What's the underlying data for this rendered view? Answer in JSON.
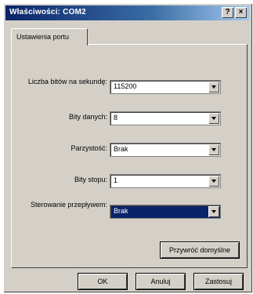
{
  "window": {
    "title": "Właściwości: COM2",
    "help": "?",
    "close": "×"
  },
  "tabs": [
    {
      "label": "Ustawienia portu"
    }
  ],
  "fields": [
    {
      "label": "Liczba bitów na sekundę:",
      "value": "115200"
    },
    {
      "label": "Bity danych:",
      "value": "8"
    },
    {
      "label": "Parzystość:",
      "value": "Brak"
    },
    {
      "label": "Bity stopu:",
      "value": "1"
    },
    {
      "label": "Sterowanie przepływem:",
      "value": "Brak"
    }
  ],
  "buttons": {
    "restore_defaults": "Przywróć domyślne",
    "ok": "OK",
    "cancel": "Anuluj",
    "apply": "Zastosuj"
  }
}
